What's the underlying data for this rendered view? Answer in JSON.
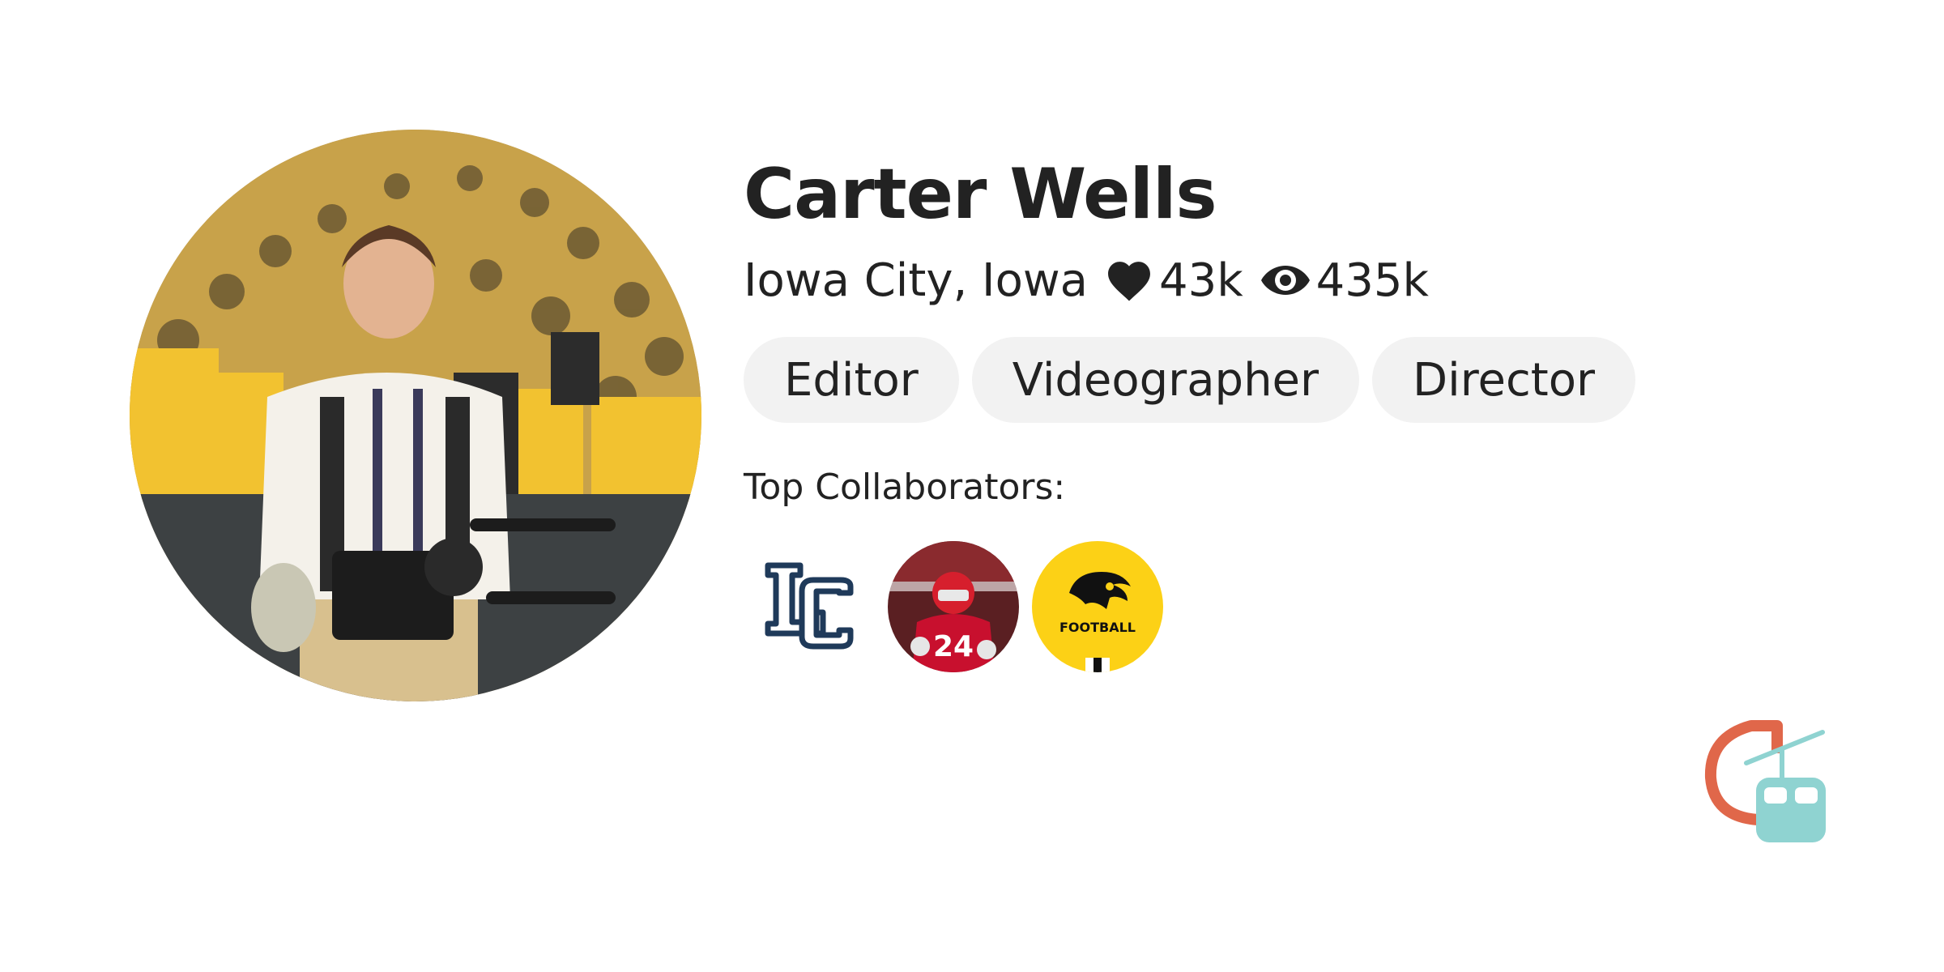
{
  "profile": {
    "name": "Carter Wells",
    "location": "Iowa City, Iowa",
    "likes": "43k",
    "views": "435k",
    "roles": [
      "Editor",
      "Videographer",
      "Director"
    ]
  },
  "collaborators": {
    "heading": "Top Collaborators:",
    "items": [
      {
        "icon": "lc-monogram-logo",
        "color": "#1f3a5a"
      },
      {
        "icon": "football-player-photo",
        "color": "#c8102e"
      },
      {
        "icon": "hawkeye-logo",
        "label": "FOOTBALL",
        "color": "#fcd116"
      }
    ]
  },
  "icons": {
    "likes": "heart-icon",
    "views": "eye-icon",
    "brand": "gondola-brand-logo"
  },
  "colors": {
    "text": "#222222",
    "chip_background": "#f2f2f2",
    "brand_orange": "#e0674a",
    "brand_teal": "#8fd3d1"
  }
}
